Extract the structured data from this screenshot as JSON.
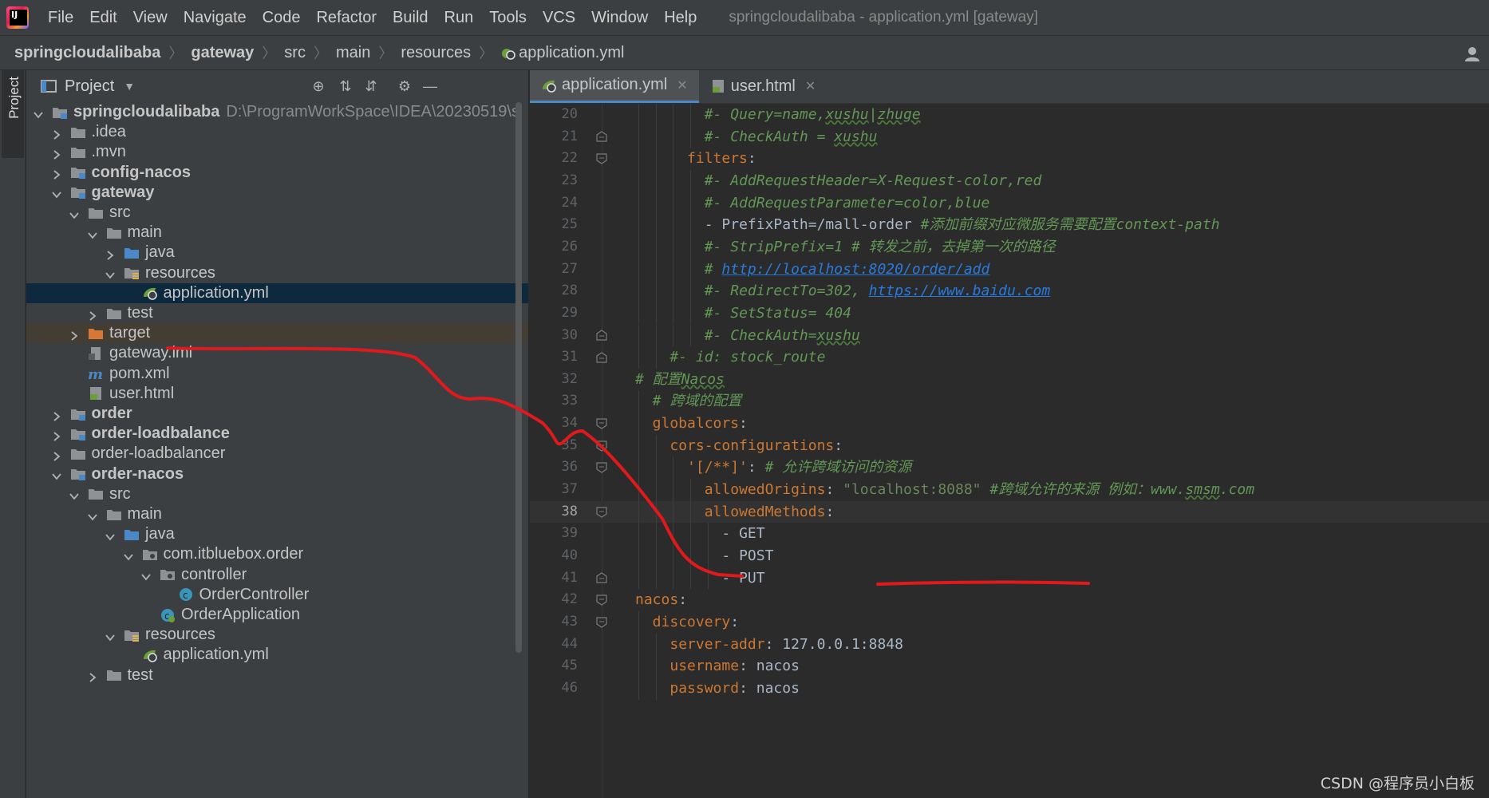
{
  "menubar": {
    "items": [
      "File",
      "Edit",
      "View",
      "Navigate",
      "Code",
      "Refactor",
      "Build",
      "Run",
      "Tools",
      "VCS",
      "Window",
      "Help"
    ],
    "window_title": "springcloudalibaba - application.yml [gateway]"
  },
  "breadcrumb": [
    "springcloudalibaba",
    "gateway",
    "src",
    "main",
    "resources",
    "application.yml"
  ],
  "tool_strip": {
    "project_label": "Project"
  },
  "project_panel": {
    "title": "Project",
    "tree": [
      {
        "label": "springcloudalibaba",
        "hint": "D:\\ProgramWorkSpace\\IDEA\\20230519\\s",
        "depth": 0,
        "arrow": "open",
        "icon": "module",
        "bold": true
      },
      {
        "label": ".idea",
        "depth": 1,
        "arrow": "closed",
        "icon": "folder"
      },
      {
        "label": ".mvn",
        "depth": 1,
        "arrow": "closed",
        "icon": "folder"
      },
      {
        "label": "config-nacos",
        "depth": 1,
        "arrow": "closed",
        "icon": "module",
        "bold": true
      },
      {
        "label": "gateway",
        "depth": 1,
        "arrow": "open",
        "icon": "module",
        "bold": true
      },
      {
        "label": "src",
        "depth": 2,
        "arrow": "open",
        "icon": "folder"
      },
      {
        "label": "main",
        "depth": 3,
        "arrow": "open",
        "icon": "folder"
      },
      {
        "label": "java",
        "depth": 4,
        "arrow": "closed",
        "icon": "folder-blue"
      },
      {
        "label": "resources",
        "depth": 4,
        "arrow": "open",
        "icon": "folder-res"
      },
      {
        "label": "application.yml",
        "depth": 5,
        "arrow": "none",
        "icon": "yml",
        "selected": true
      },
      {
        "label": "test",
        "depth": 3,
        "arrow": "closed",
        "icon": "folder"
      },
      {
        "label": "target",
        "depth": 2,
        "arrow": "closed",
        "icon": "folder-orange",
        "target": true
      },
      {
        "label": "gateway.iml",
        "depth": 2,
        "arrow": "none",
        "icon": "iml"
      },
      {
        "label": "pom.xml",
        "depth": 2,
        "arrow": "none",
        "icon": "maven"
      },
      {
        "label": "user.html",
        "depth": 2,
        "arrow": "none",
        "icon": "html"
      },
      {
        "label": "order",
        "depth": 1,
        "arrow": "closed",
        "icon": "module",
        "bold": true
      },
      {
        "label": "order-loadbalance",
        "depth": 1,
        "arrow": "closed",
        "icon": "module",
        "bold": true
      },
      {
        "label": "order-loadbalancer",
        "depth": 1,
        "arrow": "closed",
        "icon": "folder"
      },
      {
        "label": "order-nacos",
        "depth": 1,
        "arrow": "open",
        "icon": "module",
        "bold": true
      },
      {
        "label": "src",
        "depth": 2,
        "arrow": "open",
        "icon": "folder"
      },
      {
        "label": "main",
        "depth": 3,
        "arrow": "open",
        "icon": "folder"
      },
      {
        "label": "java",
        "depth": 4,
        "arrow": "open",
        "icon": "folder-blue"
      },
      {
        "label": "com.itbluebox.order",
        "depth": 5,
        "arrow": "open",
        "icon": "package"
      },
      {
        "label": "controller",
        "depth": 6,
        "arrow": "open",
        "icon": "package"
      },
      {
        "label": "OrderController",
        "depth": 7,
        "arrow": "none",
        "icon": "class"
      },
      {
        "label": "OrderApplication",
        "depth": 6,
        "arrow": "none",
        "icon": "spring-class"
      },
      {
        "label": "resources",
        "depth": 4,
        "arrow": "open",
        "icon": "folder-res"
      },
      {
        "label": "application.yml",
        "depth": 5,
        "arrow": "none",
        "icon": "yml"
      },
      {
        "label": "test",
        "depth": 3,
        "arrow": "closed",
        "icon": "folder"
      }
    ]
  },
  "editor": {
    "tabs": [
      {
        "label": "application.yml",
        "active": true,
        "icon": "yml"
      },
      {
        "label": "user.html",
        "active": false,
        "icon": "html"
      }
    ],
    "current_line": 38,
    "lines": [
      {
        "n": 20,
        "indent": 8,
        "fold": "none",
        "segs": [
          [
            "c",
            "#- Query=name,"
          ],
          [
            "cw",
            "xushu"
          ],
          [
            "c",
            "|"
          ],
          [
            "cw",
            "zhuge"
          ]
        ]
      },
      {
        "n": 21,
        "indent": 8,
        "fold": "end",
        "segs": [
          [
            "c",
            "#- CheckAuth = "
          ],
          [
            "cw",
            "xushu"
          ]
        ]
      },
      {
        "n": 22,
        "indent": 6,
        "fold": "start",
        "segs": [
          [
            "k",
            "filters"
          ],
          [
            "p",
            ":"
          ]
        ]
      },
      {
        "n": 23,
        "indent": 8,
        "fold": "none",
        "segs": [
          [
            "c",
            "#- AddRequestHeader=X-Request-color,red"
          ]
        ]
      },
      {
        "n": 24,
        "indent": 8,
        "fold": "none",
        "segs": [
          [
            "c",
            "#- AddRequestParameter=color,blue"
          ]
        ]
      },
      {
        "n": 25,
        "indent": 8,
        "fold": "none",
        "segs": [
          [
            "p",
            "- PrefixPath=/mall-order "
          ],
          [
            "c",
            "#添加前缀对应微服务需要配置context-path"
          ]
        ]
      },
      {
        "n": 26,
        "indent": 8,
        "fold": "none",
        "segs": [
          [
            "c",
            "#- StripPrefix=1 # 转发之前，去掉第一次的路径"
          ]
        ]
      },
      {
        "n": 27,
        "indent": 8,
        "fold": "none",
        "segs": [
          [
            "c",
            "# "
          ],
          [
            "u",
            "http://localhost:8020/order/add"
          ]
        ]
      },
      {
        "n": 28,
        "indent": 8,
        "fold": "none",
        "segs": [
          [
            "c",
            "#- RedirectTo=302, "
          ],
          [
            "u",
            "https://www.baidu.com"
          ]
        ]
      },
      {
        "n": 29,
        "indent": 8,
        "fold": "none",
        "segs": [
          [
            "c",
            "#- SetStatus= 404"
          ]
        ]
      },
      {
        "n": 30,
        "indent": 8,
        "fold": "end",
        "segs": [
          [
            "c",
            "#- CheckAuth="
          ],
          [
            "cw",
            "xushu"
          ]
        ]
      },
      {
        "n": 31,
        "indent": 4,
        "fold": "end",
        "segs": [
          [
            "c",
            "#- id: stock_route"
          ]
        ]
      },
      {
        "n": 32,
        "indent": 0,
        "fold": "none",
        "segs": [
          [
            "c",
            "# 配置"
          ],
          [
            "cw",
            "Nacos"
          ]
        ]
      },
      {
        "n": 33,
        "indent": 2,
        "fold": "none",
        "segs": [
          [
            "c",
            "# 跨域的配置"
          ]
        ]
      },
      {
        "n": 34,
        "indent": 2,
        "fold": "start",
        "segs": [
          [
            "k",
            "globalcors"
          ],
          [
            "p",
            ":"
          ]
        ]
      },
      {
        "n": 35,
        "indent": 4,
        "fold": "start",
        "segs": [
          [
            "k",
            "cors-configurations"
          ],
          [
            "p",
            ":"
          ]
        ]
      },
      {
        "n": 36,
        "indent": 6,
        "fold": "start",
        "segs": [
          [
            "k",
            "'[/**]'"
          ],
          [
            "p",
            ": "
          ],
          [
            "c",
            "# 允许跨域访问的资源"
          ]
        ]
      },
      {
        "n": 37,
        "indent": 8,
        "fold": "none",
        "segs": [
          [
            "k",
            "allowedOrigins"
          ],
          [
            "p",
            ": "
          ],
          [
            "s",
            "\"localhost:8088\""
          ],
          [
            "p",
            " "
          ],
          [
            "c",
            "#跨域允许的来源 例如：www."
          ],
          [
            "cw",
            "smsm"
          ],
          [
            "c",
            ".com"
          ]
        ]
      },
      {
        "n": 38,
        "indent": 8,
        "fold": "start",
        "segs": [
          [
            "k",
            "allowedMethods"
          ],
          [
            "p",
            ":"
          ]
        ]
      },
      {
        "n": 39,
        "indent": 10,
        "fold": "none",
        "segs": [
          [
            "p",
            "- GET"
          ]
        ]
      },
      {
        "n": 40,
        "indent": 10,
        "fold": "none",
        "segs": [
          [
            "p",
            "- POST"
          ]
        ]
      },
      {
        "n": 41,
        "indent": 10,
        "fold": "end",
        "segs": [
          [
            "p",
            "- PUT"
          ]
        ]
      },
      {
        "n": 42,
        "indent": 0,
        "fold": "start",
        "segs": [
          [
            "k",
            "nacos"
          ],
          [
            "p",
            ":"
          ]
        ]
      },
      {
        "n": 43,
        "indent": 2,
        "fold": "start",
        "segs": [
          [
            "k",
            "discovery"
          ],
          [
            "p",
            ":"
          ]
        ]
      },
      {
        "n": 44,
        "indent": 4,
        "fold": "none",
        "segs": [
          [
            "k",
            "server-addr"
          ],
          [
            "p",
            ": 127.0.0.1:8848"
          ]
        ]
      },
      {
        "n": 45,
        "indent": 4,
        "fold": "none",
        "segs": [
          [
            "k",
            "username"
          ],
          [
            "p",
            ": nacos"
          ]
        ]
      },
      {
        "n": 46,
        "indent": 4,
        "fold": "none",
        "segs": [
          [
            "k",
            "password"
          ],
          [
            "p",
            ": nacos"
          ]
        ]
      }
    ]
  },
  "watermark": "CSDN @程序员小白板",
  "colors": {
    "annotation": "#e0191c",
    "selection": "#0d293e",
    "keyword": "#cc7832",
    "comment": "#629755",
    "string": "#6a8759"
  }
}
